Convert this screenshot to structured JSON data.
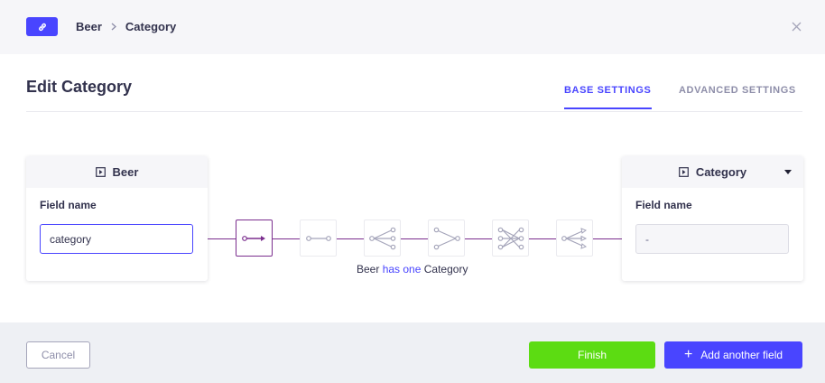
{
  "header": {
    "breadcrumb": [
      "Beer",
      "Category"
    ],
    "accent_color": "#4945ff"
  },
  "title": "Edit Category",
  "tabs": [
    {
      "label": "BASE SETTINGS",
      "active": true
    },
    {
      "label": "ADVANCED SETTINGS",
      "active": false
    }
  ],
  "left_card": {
    "title": "Beer",
    "field_label": "Field name",
    "field_value": "category"
  },
  "right_card": {
    "title": "Category",
    "field_label": "Field name",
    "field_value": "-"
  },
  "relation": {
    "types": [
      "has-one",
      "one-to-one",
      "one-to-many",
      "many-to-one",
      "many-to-many",
      "has-many"
    ],
    "selected": "has-one",
    "text_subject": "Beer",
    "text_relation": "has one",
    "text_object": "Category",
    "line_color": "#7b2e8e"
  },
  "footer": {
    "cancel_label": "Cancel",
    "finish_label": "Finish",
    "add_label": "Add another field",
    "finish_color": "#5cdc12",
    "add_color": "#4945ff"
  }
}
